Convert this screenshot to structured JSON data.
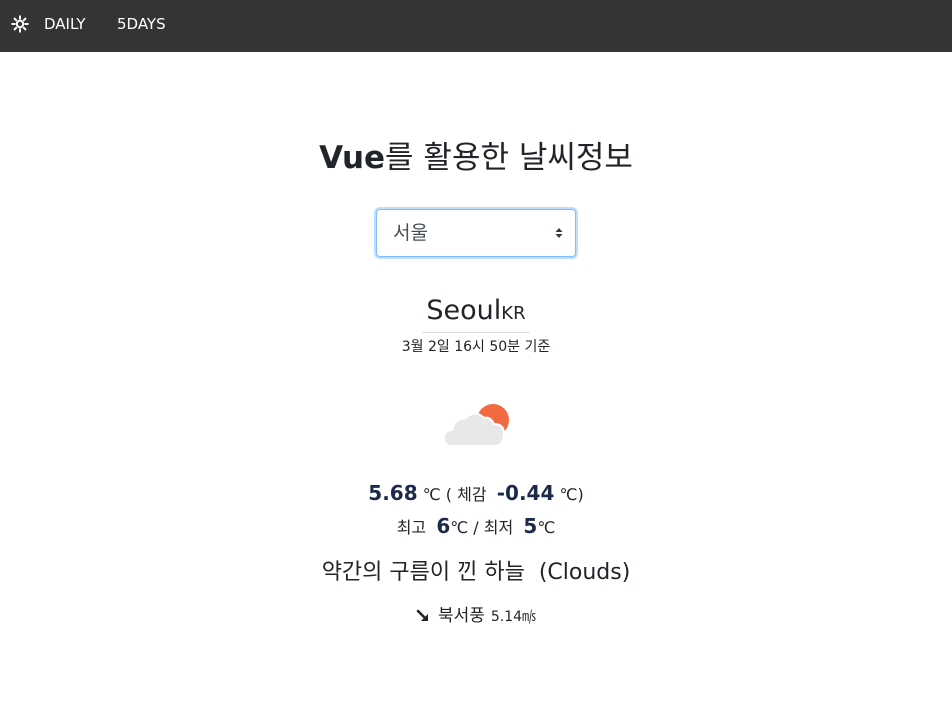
{
  "nav": {
    "logo_icon": "sun-gear-icon",
    "items": [
      {
        "label": "DAILY"
      },
      {
        "label": "5DAYS"
      }
    ]
  },
  "title": {
    "strong": "Vue",
    "rest": "를 활용한 날씨정보"
  },
  "city_select": {
    "selected": "서울",
    "icon": "sort-arrows-icon"
  },
  "city": {
    "name": "Seoul",
    "country": "KR",
    "timestamp": "3월 2일 16시 50분 기준"
  },
  "weather": {
    "icon": "cloud-with-sun-icon",
    "temp": "5.68",
    "temp_unit": "℃ ( 체감",
    "feels_like": "-0.44",
    "feels_unit": "℃)",
    "max_label": "최고",
    "max": "6",
    "max_unit": "℃ / 최저",
    "min": "5",
    "min_unit": "℃",
    "description": "약간의 구름이 낀 하늘",
    "main": "(Clouds)",
    "wind_icon": "arrow-down-right-icon",
    "wind_dir": "북서풍",
    "wind_speed": "5.14㎧"
  },
  "colors": {
    "navbar": "#343434",
    "accent_value": "#1c2a4a",
    "sun": "#f26a43",
    "cloud": "#e8e8e8",
    "select_focus": "#80bdff"
  }
}
